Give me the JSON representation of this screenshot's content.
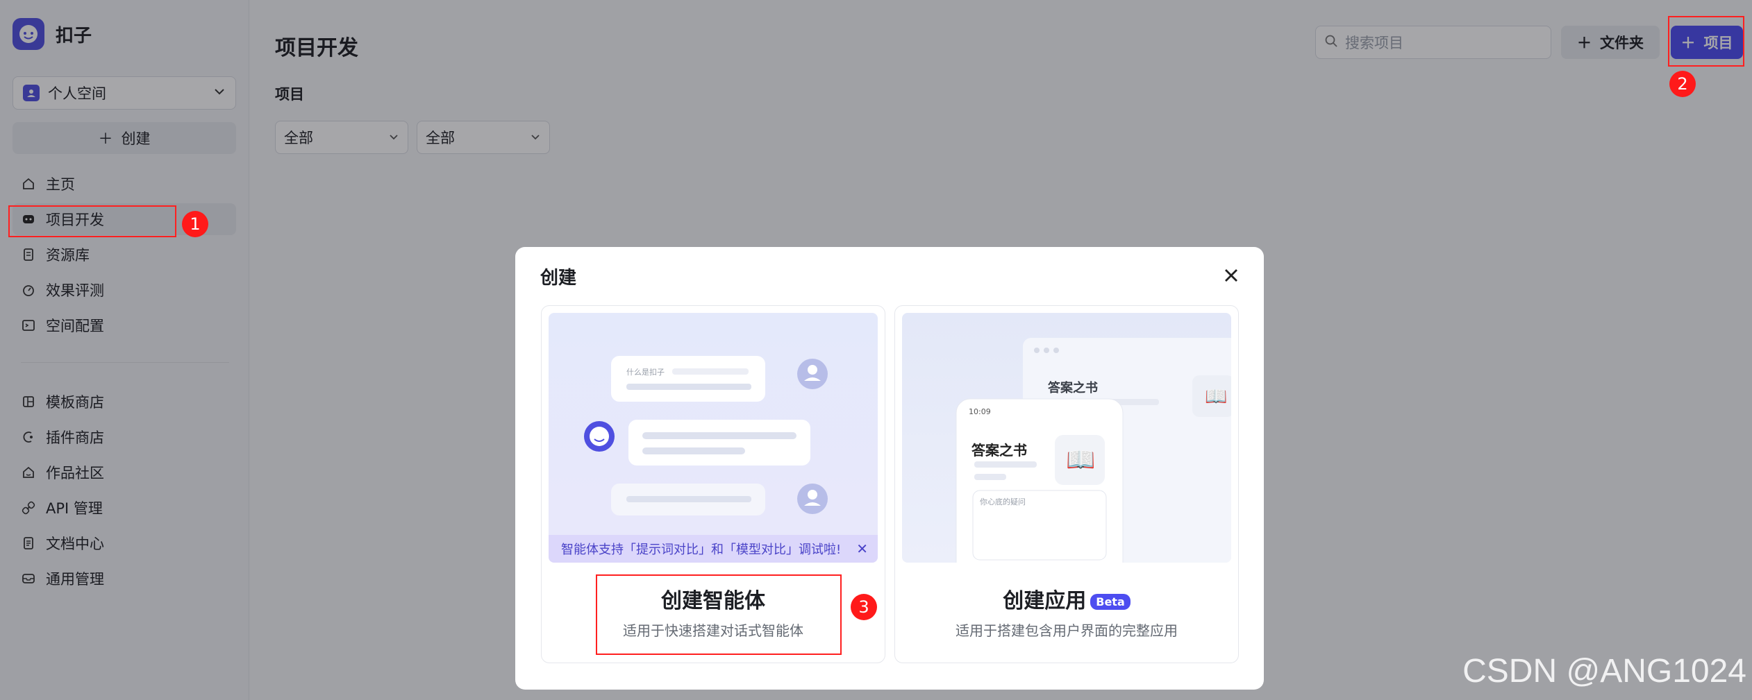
{
  "brand": {
    "name": "扣子"
  },
  "sidebar": {
    "space": "个人空间",
    "create_label": "创建",
    "items": [
      {
        "label": "主页",
        "icon": "home-icon"
      },
      {
        "label": "项目开发",
        "icon": "bot-icon",
        "active": true
      },
      {
        "label": "资源库",
        "icon": "library-icon"
      },
      {
        "label": "效果评测",
        "icon": "gauge-icon"
      },
      {
        "label": "空间配置",
        "icon": "settings-icon"
      }
    ],
    "items2": [
      {
        "label": "模板商店",
        "icon": "template-icon"
      },
      {
        "label": "插件商店",
        "icon": "plugin-icon"
      },
      {
        "label": "作品社区",
        "icon": "community-icon"
      },
      {
        "label": "API 管理",
        "icon": "api-icon"
      },
      {
        "label": "文档中心",
        "icon": "doc-icon"
      },
      {
        "label": "通用管理",
        "icon": "inbox-icon"
      }
    ]
  },
  "main": {
    "title": "项目开发",
    "section": "项目",
    "filters": [
      "全部",
      "全部"
    ],
    "search_placeholder": "搜索项目",
    "folder_label": "文件夹",
    "project_label": "项目"
  },
  "modal": {
    "title": "创建",
    "agent": {
      "title": "创建智能体",
      "desc": "适用于快速搭建对话式智能体",
      "tip": "智能体支持「提示词对比」和「模型对比」调试啦!",
      "chat_hint": "什么是扣子"
    },
    "app": {
      "title": "创建应用",
      "beta": "Beta",
      "desc": "适用于搭建包含用户界面的完整应用",
      "preview_title": "答案之书",
      "phone_time": "10:09",
      "phone_title": "答案之书",
      "input_hint": "你心底的疑问"
    }
  },
  "annotations": [
    "1",
    "2",
    "3"
  ],
  "watermark": "CSDN @ANG1024",
  "colors": {
    "accent": "#4d4df0",
    "annotation": "#ff1a1a"
  }
}
